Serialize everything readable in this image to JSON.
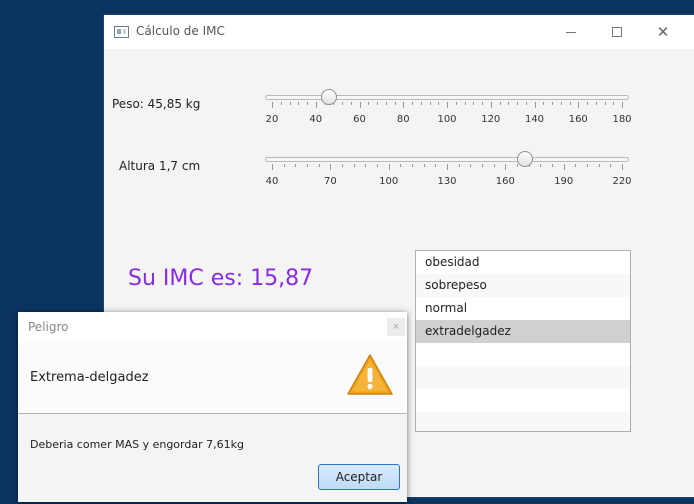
{
  "window": {
    "title": "Cálculo de IMC",
    "close_symbol": "✕"
  },
  "peso": {
    "label": "Peso: 45,85 kg",
    "min": 20,
    "max": 180,
    "value": 45.85,
    "tick_labels": [
      "20",
      "40",
      "60",
      "80",
      "100",
      "120",
      "140",
      "160",
      "180"
    ]
  },
  "altura": {
    "label": "Altura 1,7 cm",
    "min": 40,
    "max": 220,
    "value": 170,
    "tick_labels": [
      "40",
      "70",
      "100",
      "130",
      "160",
      "190",
      "220"
    ]
  },
  "result": {
    "text": "Su IMC es: 15,87"
  },
  "categories": {
    "items": [
      "obesidad",
      "sobrepeso",
      "normal",
      "extradelgadez"
    ],
    "selected_index": 3
  },
  "dialog": {
    "title": "Peligro",
    "header": "Extrema-delgadez",
    "content": "Deberia comer MAS y engordar 7,61kg",
    "accept_label": "Aceptar",
    "close_symbol": "×"
  },
  "colors": {
    "imc_text": "#8a2be2",
    "desktop": "#0b3461",
    "warning": "#f0a21b"
  },
  "icons": {
    "dialog": "warning-icon"
  }
}
